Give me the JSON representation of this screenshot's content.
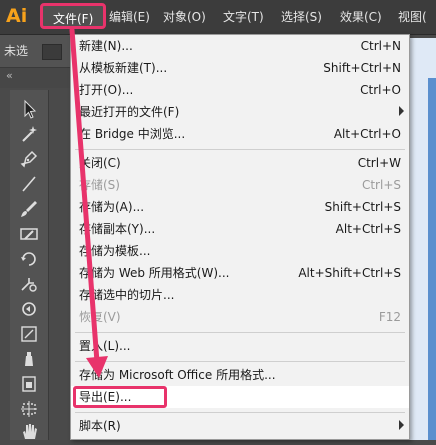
{
  "app": {
    "logo": "Ai"
  },
  "menubar": {
    "items": [
      {
        "label": "文件(F)"
      },
      {
        "label": "编辑(E)"
      },
      {
        "label": "对象(O)"
      },
      {
        "label": "文字(T)"
      },
      {
        "label": "选择(S)"
      },
      {
        "label": "效果(C)"
      },
      {
        "label": "视图("
      }
    ]
  },
  "control_bar": {
    "selection_label": "未选",
    "panel_toggle": "«"
  },
  "file_menu": {
    "items": [
      {
        "label": "新建(N)...",
        "shortcut": "Ctrl+N"
      },
      {
        "label": "从模板新建(T)...",
        "shortcut": "Shift+Ctrl+N"
      },
      {
        "label": "打开(O)...",
        "shortcut": "Ctrl+O"
      },
      {
        "label": "最近打开的文件(F)",
        "shortcut": ""
      },
      {
        "label": "在 Bridge 中浏览...",
        "shortcut": "Alt+Ctrl+O"
      },
      {
        "label": "关闭(C)",
        "shortcut": "Ctrl+W"
      },
      {
        "label": "存储(S)",
        "shortcut": "Ctrl+S"
      },
      {
        "label": "存储为(A)...",
        "shortcut": "Shift+Ctrl+S"
      },
      {
        "label": "存储副本(Y)...",
        "shortcut": "Alt+Ctrl+S"
      },
      {
        "label": "存储为模板...",
        "shortcut": ""
      },
      {
        "label": "存储为 Web 所用格式(W)...",
        "shortcut": "Alt+Shift+Ctrl+S"
      },
      {
        "label": "存储选中的切片...",
        "shortcut": ""
      },
      {
        "label": "恢复(V)",
        "shortcut": "F12"
      },
      {
        "label": "置入(L)...",
        "shortcut": ""
      },
      {
        "label": "存储为 Microsoft Office 所用格式...",
        "shortcut": ""
      },
      {
        "label": "导出(E)...",
        "shortcut": ""
      },
      {
        "label": "脚本(R)",
        "shortcut": ""
      }
    ]
  },
  "colors": {
    "highlight": "#e8336b",
    "menubar": "#3c3c3c",
    "menu_bg": "#f2f2f2",
    "logo": "#f7a21b"
  },
  "icons": [
    "selection-tool-icon",
    "magic-wand-tool-icon",
    "pen-tool-icon",
    "line-tool-icon",
    "brush-tool-icon",
    "pencil-tool-icon",
    "rotate-tool-icon",
    "scale-tool-icon",
    "warp-tool-icon",
    "free-transform-tool-icon",
    "symbol-sprayer-tool-icon",
    "graph-tool-icon",
    "artboard-tool-icon",
    "hand-tool-icon"
  ]
}
